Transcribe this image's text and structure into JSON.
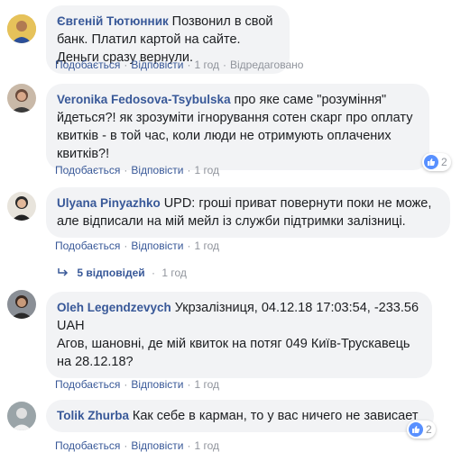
{
  "comments": [
    {
      "author": "Євгеній Тютюнник",
      "text": "Позвонил в свой банк. Платил картой на сайте. Деньги сразу вернули.",
      "like": "Подобається",
      "reply": "Відповісти",
      "time": "1 год",
      "edited": "Відредаговано"
    },
    {
      "author": "Veronika Fedosova-Tsybulska",
      "text": "про яке саме \"розуміння\" йдеться?! як зрозуміти ігнорування сотен скарг про оплату квитків - в той час, коли люди не отримують оплачених квитків?!",
      "like": "Подобається",
      "reply": "Відповісти",
      "time": "1 год",
      "reaction_count": "2"
    },
    {
      "author": "Ulyana Pinyazhko",
      "text": "UPD: гроші приват повернути поки не може, але відписали на мій мейл із служби підтримки залізниці.",
      "like": "Подобається",
      "reply": "Відповісти",
      "time": "1 год",
      "replies_label": "5 відповідей",
      "replies_time": "1 год"
    },
    {
      "author": "Oleh Legendzevych",
      "text": "Укрзалізниця, 04.12.18 17:03:54, -233.56 UAH\nАгов, шановні, де мій квиток на потяг 049 Київ-Трускавець на 28.12.18?",
      "like": "Подобається",
      "reply": "Відповісти",
      "time": "1 год"
    },
    {
      "author": "Tolik Zhurba",
      "text": "Как себе в карман, то у вас ничего не зависает",
      "like": "Подобається",
      "reply": "Відповісти",
      "time": "1 год",
      "reaction_count": "2"
    }
  ],
  "separator": "·",
  "colors": {
    "link": "#385898",
    "muted": "#90949c",
    "bubble": "#f2f3f5",
    "like_blue": "#5890ff"
  }
}
